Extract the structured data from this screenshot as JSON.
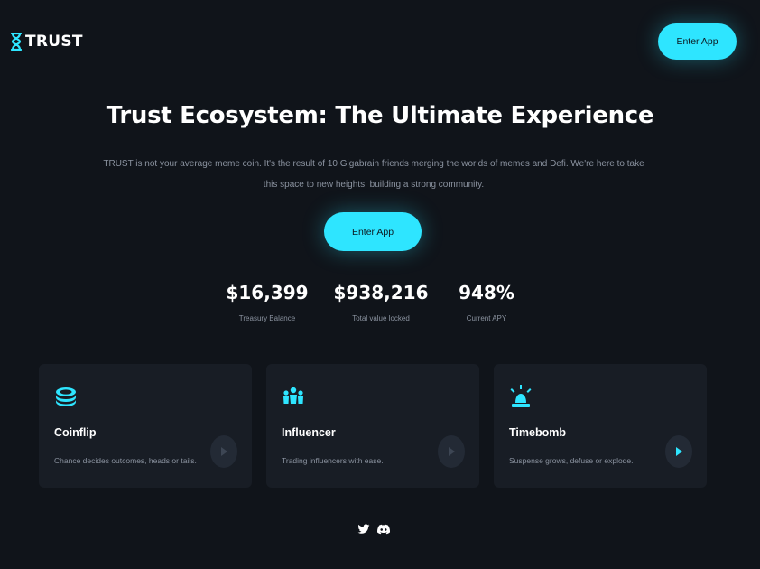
{
  "header": {
    "brand": "TRUST",
    "enter_app": "Enter App"
  },
  "hero": {
    "title": "Trust Ecosystem: The Ultimate Experience",
    "description": "TRUST is not your average meme coin. It's the result of 10 Gigabrain friends merging the worlds of memes and Defi. We're here to take this space to new heights, building a strong community.",
    "enter_app": "Enter App"
  },
  "stats": [
    {
      "value": "$16,399",
      "label": "Treasury Balance"
    },
    {
      "value": "$938,216",
      "label": "Total value locked"
    },
    {
      "value": "948%",
      "label": "Current APY"
    }
  ],
  "cards": [
    {
      "title": "Coinflip",
      "description": "Chance decides outcomes, heads or tails.",
      "icon": "coin-stack-icon",
      "arrow_state": "muted"
    },
    {
      "title": "Influencer",
      "description": "Trading influencers with ease.",
      "icon": "people-group-icon",
      "arrow_state": "muted"
    },
    {
      "title": "Timebomb",
      "description": "Suspense grows, defuse or explode.",
      "icon": "siren-icon",
      "arrow_state": "active"
    }
  ],
  "footer": {
    "socials": [
      "twitter-icon",
      "discord-icon"
    ]
  },
  "colors": {
    "background": "#10141a",
    "accent": "#2ee5ff",
    "card": "#181d25",
    "muted_text": "#8b93a0"
  }
}
